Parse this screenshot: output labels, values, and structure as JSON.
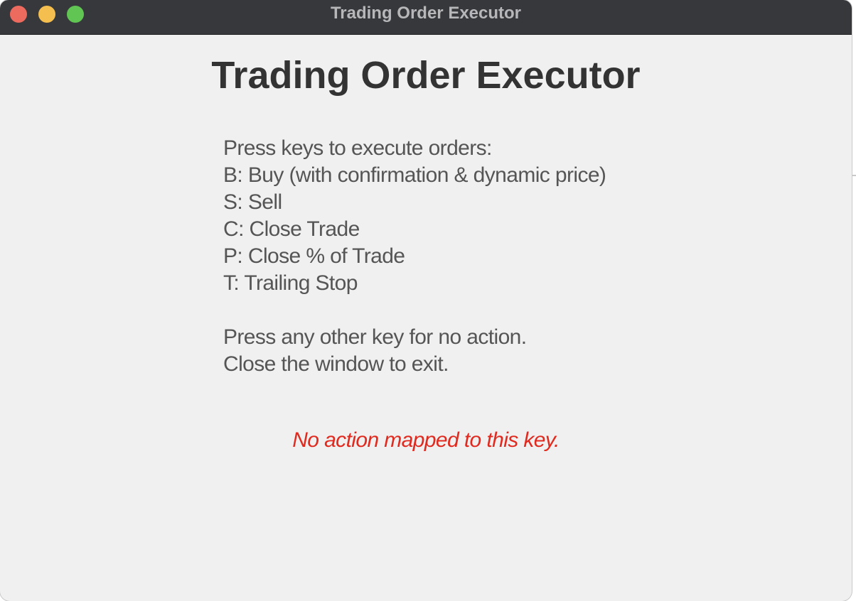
{
  "window": {
    "title": "Trading Order Executor",
    "controls": {
      "close_color": "#ed6a5e",
      "minimize_color": "#f5bf4f",
      "zoom_color": "#61c554"
    }
  },
  "main": {
    "heading": "Trading Order Executor",
    "instructions": {
      "intro": "Press keys to execute orders:",
      "keys": [
        "B: Buy (with confirmation & dynamic price)",
        "S: Sell",
        "C: Close Trade",
        "P: Close % of Trade",
        "T: Trailing Stop"
      ],
      "footer": [
        "Press any other key for no action.",
        "Close the window to exit."
      ]
    },
    "status_message": "No action mapped to this key.",
    "status_color": "#e02a1f"
  }
}
